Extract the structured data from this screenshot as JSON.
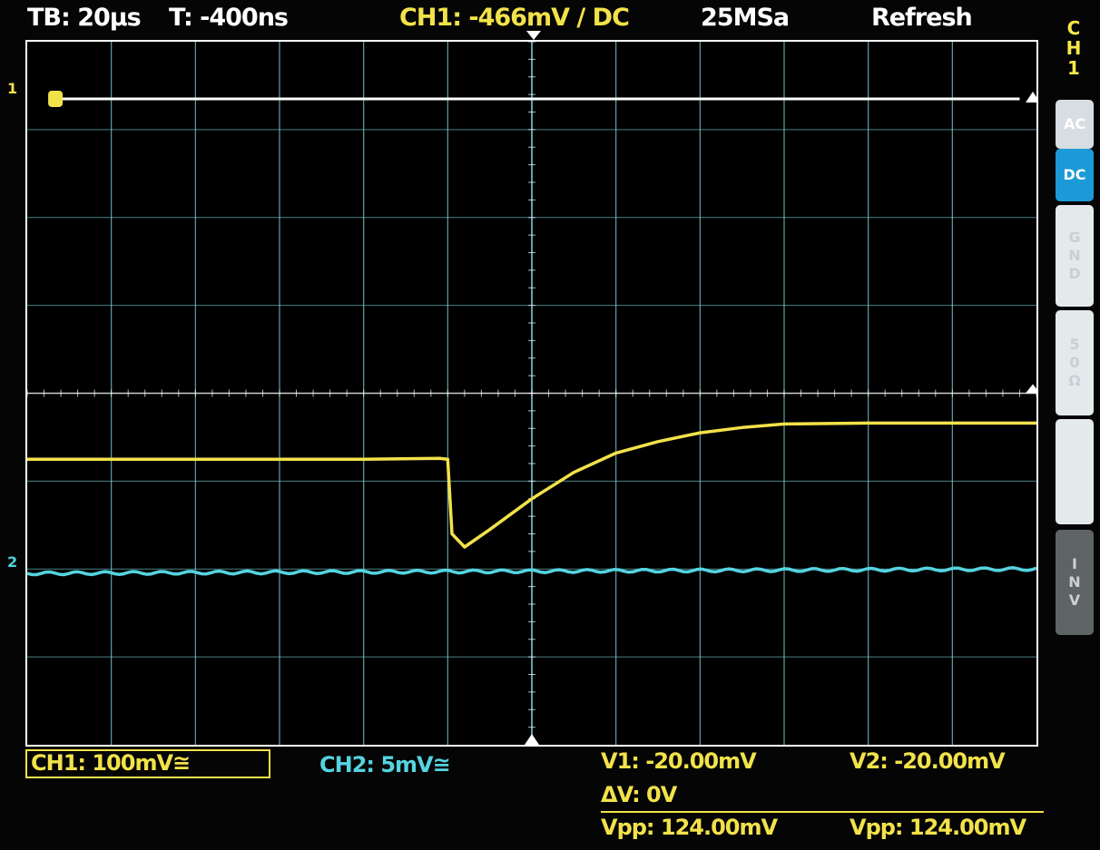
{
  "top_bar": {
    "timebase": "TB: 20µs",
    "trigger_time": "T: -400ns",
    "ch1_info": "CH1: -466mV / DC",
    "sample_rate": "25MSa",
    "mode": "Refresh"
  },
  "side_menu": {
    "channel_header": [
      "C",
      "H",
      "1"
    ],
    "keys": [
      {
        "label": "AC",
        "state": "normal"
      },
      {
        "label": "DC",
        "state": "selected"
      },
      {
        "label": "G\nN\nD",
        "state": "normal"
      },
      {
        "label": "5\n0\nΩ",
        "state": "normal"
      },
      {
        "label": "",
        "state": "normal"
      },
      {
        "label": "I\nN\nV",
        "state": "disabled"
      }
    ]
  },
  "markers": {
    "ch1_marker": "1",
    "ch2_marker": "2"
  },
  "bottom_bar": {
    "ch1_scale": "CH1: 100mV≅",
    "ch2_scale": "CH2: 5mV≅",
    "v1": "V1: -20.00mV",
    "v2": "V2: -20.00mV",
    "delta_v": "ΔV: 0V",
    "vpp1": "Vpp: 124.00mV",
    "vpp2": "Vpp: 124.00mV"
  },
  "colors": {
    "ch1": "#f2e24a",
    "ch2": "#55d3e0",
    "grid": "#7fd7e0",
    "accent_blue": "#1c9ad8",
    "border": "#ffffff"
  },
  "chart_data": {
    "type": "line",
    "x_divisions": 12,
    "y_divisions": 8,
    "x_unit_per_div": "20µs",
    "series": [
      {
        "channel": "CH1",
        "x": [
          0,
          2,
          4,
          4.9,
          5.0,
          5.05,
          5.2,
          5.5,
          6.0,
          6.5,
          7.0,
          7.5,
          8.0,
          8.5,
          9.0,
          10.0,
          11.0,
          12.0
        ],
        "y": [
          -0.75,
          -0.75,
          -0.75,
          -0.74,
          -0.75,
          -1.6,
          -1.75,
          -1.55,
          -1.2,
          -0.9,
          -0.68,
          -0.55,
          -0.45,
          -0.39,
          -0.35,
          -0.34,
          -0.34,
          -0.34
        ]
      },
      {
        "channel": "CH2",
        "x": [
          0,
          12
        ],
        "y": [
          -2.05,
          -2.0
        ]
      },
      {
        "channel": "REF",
        "x": [
          0.4,
          11.8
        ],
        "y": [
          3.35,
          3.35
        ]
      }
    ]
  }
}
